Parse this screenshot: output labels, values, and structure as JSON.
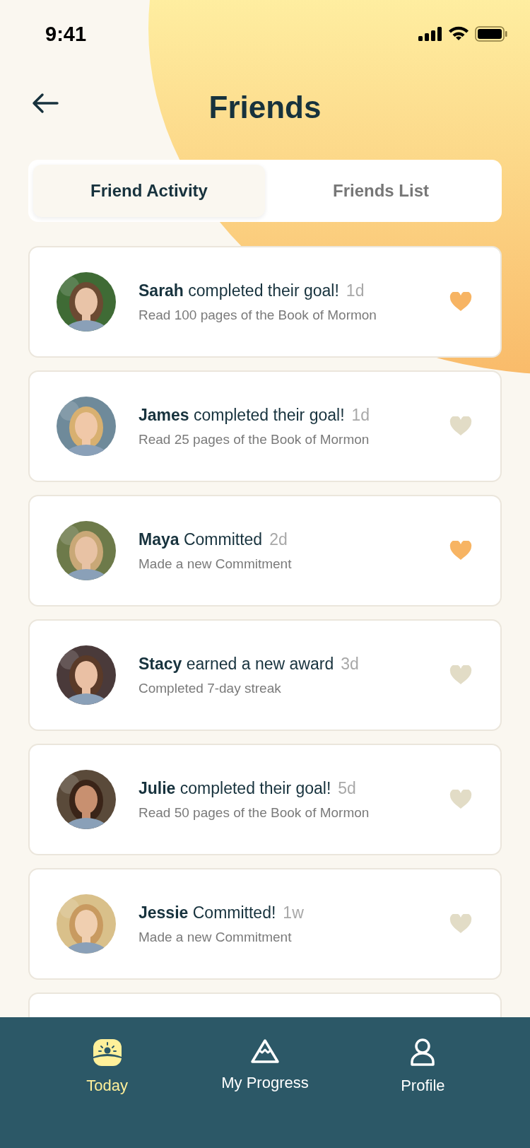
{
  "status_bar": {
    "time": "9:41"
  },
  "header": {
    "title": "Friends"
  },
  "tabs": [
    {
      "label": "Friend Activity",
      "selected": true
    },
    {
      "label": "Friends List",
      "selected": false
    }
  ],
  "activities": [
    {
      "headline": "**Sarah** completed their goal!",
      "time": "1d",
      "detail": "Read 100 pages of the Book of Mormon",
      "liked": true
    },
    {
      "headline": "**James** completed their goal!",
      "time": "1d",
      "detail": "Read 25 pages of the Book of Mormon",
      "liked": false
    },
    {
      "headline": "**Maya** Committed",
      "time": "2d",
      "detail": "Made a new Commitment",
      "liked": true
    },
    {
      "headline": "**Stacy** earned a new award",
      "time": "3d",
      "detail": "Completed 7-day streak",
      "liked": false
    },
    {
      "headline": "**Julie** completed their goal!",
      "time": "5d",
      "detail": "Read 50 pages of the Book of Mormon",
      "liked": false
    },
    {
      "headline": "**Jessie** Committed!",
      "time": "1w",
      "detail": "Made a new Commitment",
      "liked": false
    }
  ],
  "nav": [
    {
      "label": "Today",
      "selected": true
    },
    {
      "label": "My Progress",
      "selected": false
    },
    {
      "label": "Profile",
      "selected": false
    }
  ]
}
